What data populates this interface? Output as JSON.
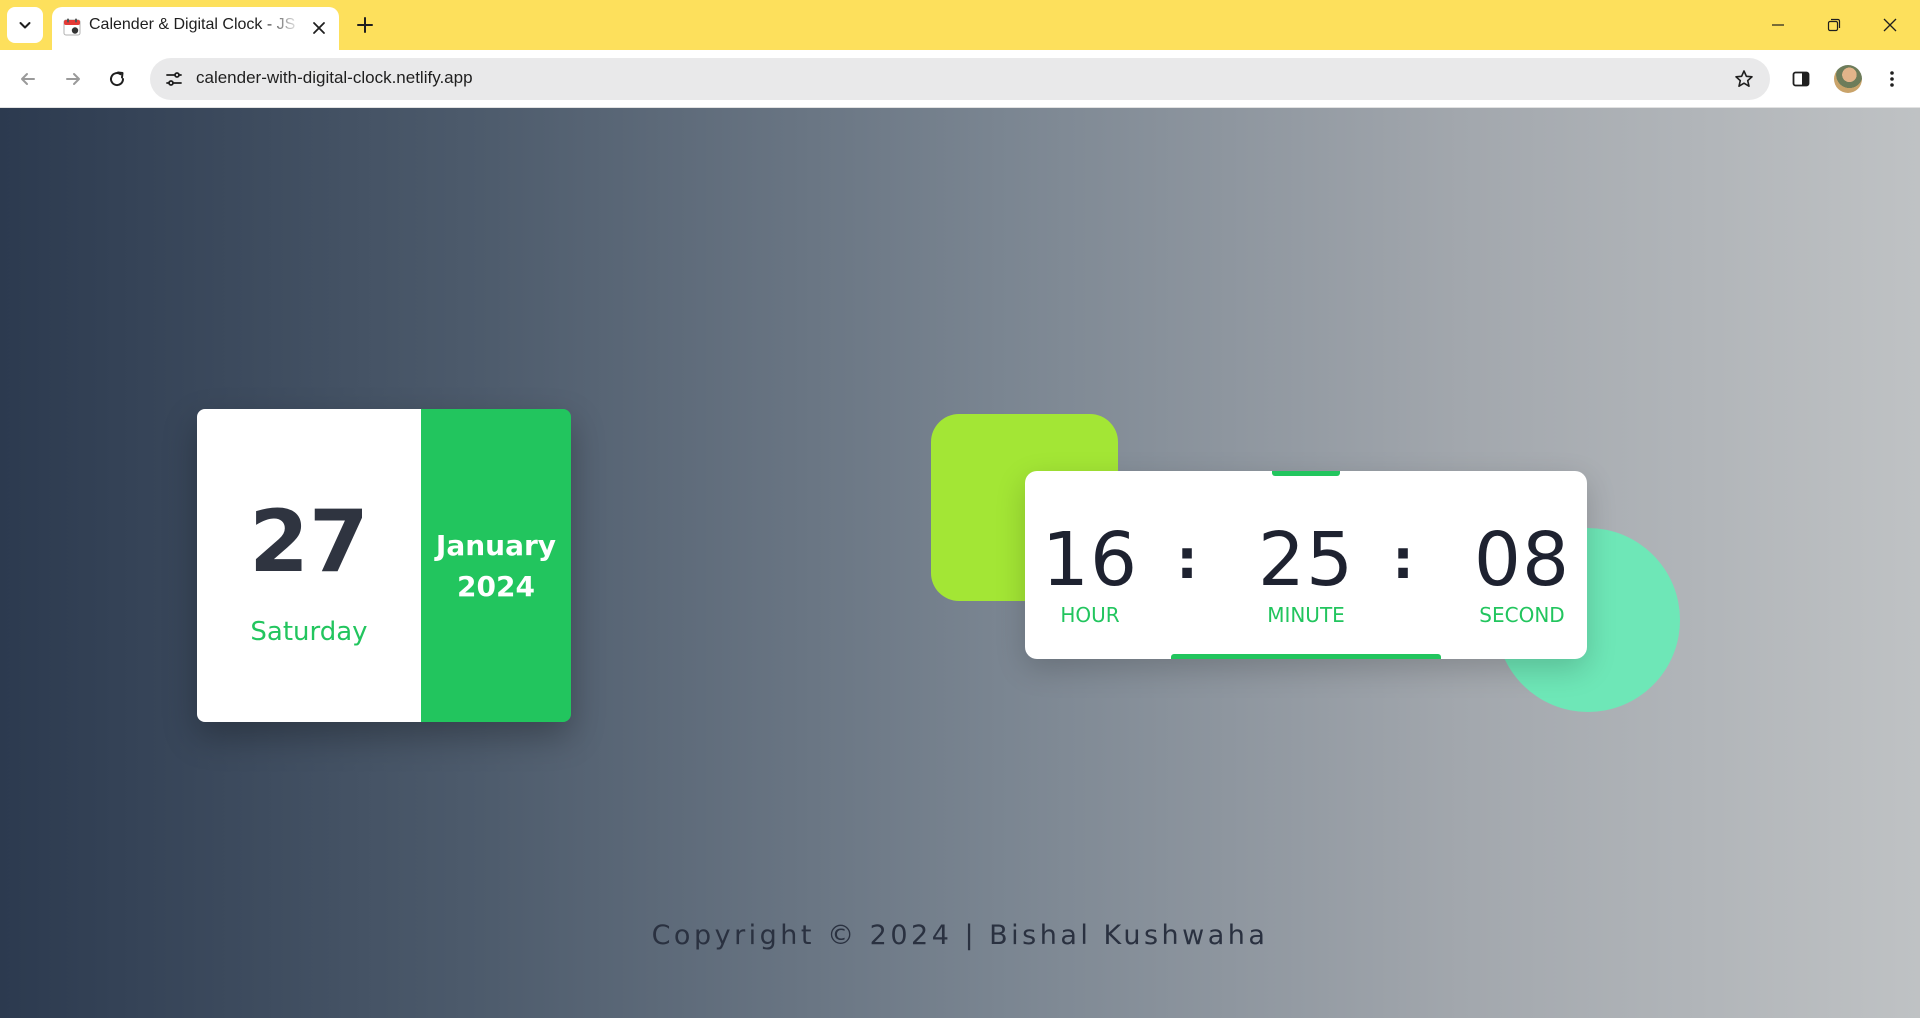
{
  "browser": {
    "tab_title": "Calender & Digital Clock - JS Mini Project",
    "url": "calender-with-digital-clock.netlify.app",
    "tabstrip_color": "#fde05c"
  },
  "icons": {
    "tab_search": "chevron-down-icon",
    "favicon": "calendar-icon",
    "tab_close": "close-icon",
    "new_tab": "plus-icon",
    "minimize": "minimize-icon",
    "restore": "restore-icon",
    "close_window": "close-icon",
    "back": "arrow-left-icon",
    "forward": "arrow-right-icon",
    "reload": "reload-icon",
    "site_info": "tune-icon",
    "bookmark": "star-icon",
    "side_panel": "side-panel-icon",
    "menu": "kebab-menu-icon"
  },
  "calendar": {
    "day": "27",
    "weekday": "Saturday",
    "month": "January",
    "year": "2024"
  },
  "clock": {
    "hour": "16",
    "hour_label": "HOUR",
    "minute": "25",
    "minute_label": "MINUTE",
    "second": "08",
    "second_label": "SECOND",
    "separator": ":"
  },
  "footer": {
    "copyright": "Copyright © 2024 | Bishal Kushwaha"
  },
  "colors": {
    "accent_green": "#22c55e",
    "lime": "#a3e635",
    "mint": "#6ee7b7",
    "text_dark": "#1e2230"
  }
}
